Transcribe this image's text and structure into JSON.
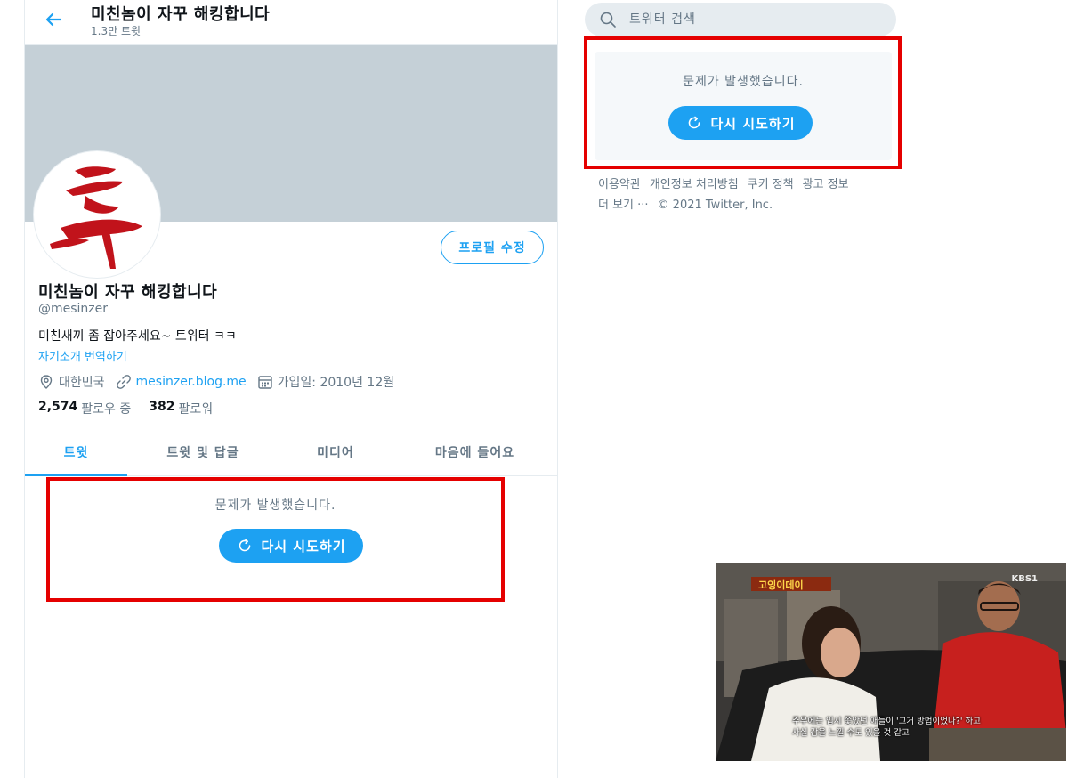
{
  "header": {
    "title": "미친놈이 자꾸 해킹합니다",
    "tweet_count": "1.3만 트윗"
  },
  "profile": {
    "edit_button": "프로필 수정",
    "name": "미친놈이 자꾸 해킹합니다",
    "handle": "@mesinzer",
    "bio": "미친새끼 좀 잡아주세요~ 트위터 ㅋㅋ",
    "translate": "자기소개 번역하기",
    "location": "대한민국",
    "website": "mesinzer.blog.me",
    "joined": "가입일: 2010년 12월",
    "following_count": "2,574",
    "following_label": "팔로우 중",
    "followers_count": "382",
    "followers_label": "팔로워"
  },
  "tabs": [
    {
      "label": "트윗",
      "active": true
    },
    {
      "label": "트윗 및 답글",
      "active": false
    },
    {
      "label": "미디어",
      "active": false
    },
    {
      "label": "마음에 들어요",
      "active": false
    }
  ],
  "timeline_error": {
    "message": "문제가 발생했습니다.",
    "retry": "다시 시도하기"
  },
  "sidebar": {
    "search_placeholder": "트위터 검색",
    "error": {
      "message": "문제가 발생했습니다.",
      "retry": "다시 시도하기"
    },
    "footer": {
      "links": [
        "이용약관",
        "개인정보 처리방침",
        "쿠키 정책",
        "광고 정보"
      ],
      "more": "더 보기 ···",
      "copyright": "© 2021 Twitter, Inc."
    }
  },
  "video": {
    "channel": "KBS1",
    "subtitle_line1": "주우에는 입시 쫓았던 애들이 '그거 방법이었나?' 하고",
    "subtitle_line2": "사실 감을 느낄 수도 있을 것 같고"
  },
  "colors": {
    "accent": "#1da1f2",
    "highlight_border": "#e50000",
    "banner": "#c5d0d7"
  }
}
